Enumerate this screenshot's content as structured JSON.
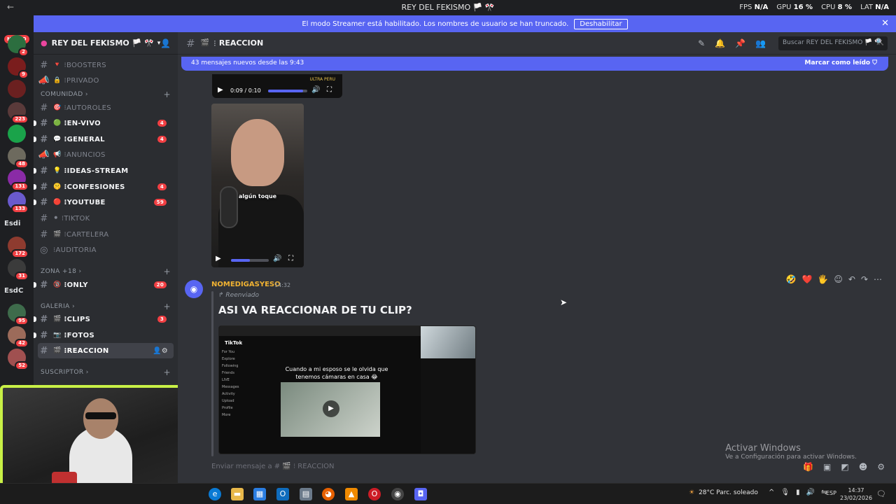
{
  "window": {
    "title": "REY DEL FEKISMO 🏳️ 🎌",
    "stats": [
      {
        "label": "FPS",
        "value": "N/A"
      },
      {
        "label": "GPU",
        "value": "16 %"
      },
      {
        "label": "CPU",
        "value": "8 %"
      },
      {
        "label": "LAT",
        "value": "N/A"
      }
    ]
  },
  "banner": {
    "text": "El modo Streamer está habilitado. Los nombres de usuario se han truncado.",
    "button": "Deshabilitar"
  },
  "rail": {
    "nuevo": "NUEVO",
    "servers": [
      {
        "badge": "2",
        "color": "#2c6e3f"
      },
      {
        "badge": "9",
        "color": "#7a1d1d"
      },
      {
        "badge": "",
        "color": "#6b2020"
      },
      {
        "badge": "223",
        "color": "#5a3a3a"
      },
      {
        "badge": "",
        "color": "#1aa34a"
      },
      {
        "badge": "48",
        "color": "#6d6a5e"
      },
      {
        "badge": "131",
        "color": "#8a2ba6"
      },
      {
        "badge": "133",
        "color": "#6a5acd"
      },
      {
        "badge": "",
        "color": "#1e1f22",
        "text": "Esdi"
      },
      {
        "badge": "172",
        "color": "#8e3b2f"
      },
      {
        "badge": "31",
        "color": "#3b3b3b"
      },
      {
        "badge": "",
        "color": "#1e1f22",
        "text": "EsdC"
      },
      {
        "badge": "95",
        "color": "#3e6b4b"
      },
      {
        "badge": "42",
        "color": "#9c6b5a"
      },
      {
        "badge": "52",
        "color": "#a05050"
      }
    ]
  },
  "sidebar": {
    "server_name": "REY DEL FEKISMO 🏳️ 🎌",
    "channels": [
      {
        "name": "BOOSTERS",
        "emoji": "🔻",
        "state": "muted",
        "count": ""
      },
      {
        "name": "PRIVADO",
        "emoji": "🔒",
        "state": "muted",
        "count": ""
      },
      {
        "name": "AUTOROLES",
        "emoji": "🎯",
        "state": "muted",
        "count": ""
      },
      {
        "name": "EN-VIVO",
        "emoji": "🟢",
        "state": "unread",
        "count": "4"
      },
      {
        "name": "GENERAL",
        "emoji": "💬",
        "state": "unread",
        "count": "4"
      },
      {
        "name": "ANUNCIOS",
        "emoji": "📢",
        "state": "muted",
        "count": ""
      },
      {
        "name": "IDEAS-STREAM",
        "emoji": "💡",
        "state": "unread",
        "count": ""
      },
      {
        "name": "CONFESIONES",
        "emoji": "🤫",
        "state": "unread",
        "count": "4"
      },
      {
        "name": "YOUTUBE",
        "emoji": "🔴",
        "state": "unread",
        "count": "59"
      },
      {
        "name": "TIKTOK",
        "emoji": "⚫",
        "state": "muted",
        "count": ""
      },
      {
        "name": "CARTELERA",
        "emoji": "🎬",
        "state": "muted",
        "count": ""
      },
      {
        "name": "AUDITORIA",
        "emoji": "",
        "state": "muted",
        "count": ""
      },
      {
        "name": "ONLY",
        "emoji": "🔞",
        "state": "unread",
        "count": "20"
      },
      {
        "name": "CLIPS",
        "emoji": "🎬",
        "state": "unread",
        "count": "3"
      },
      {
        "name": "FOTOS",
        "emoji": "📷",
        "state": "unread",
        "count": ""
      },
      {
        "name": "REACCION",
        "emoji": "🎬",
        "state": "active",
        "count": ""
      }
    ],
    "categories": [
      "COMUNIDAD",
      "ZONA +18",
      "GALERIA",
      "SUSCRIPTOR"
    ]
  },
  "header": {
    "channel": "REACCION",
    "search_placeholder": "Buscar REY DEL FEKISMO 🏳️ 🎌"
  },
  "chat": {
    "new_messages": "43 mensajes nuevos desde las 9:43",
    "mark_read": "Marcar como leído",
    "video1": {
      "time": "0:09 / 0:10",
      "brand": "ULTRA PERU",
      "progress": 0.9
    },
    "clip_caption": "algún toque",
    "clip_progress": 0.5,
    "message": {
      "author": "NOMEDIGASYESO",
      "time": "14:32",
      "forwarded": "Reenviado",
      "title": "ASI VA REACCIONAR DE TU CLIP?",
      "embed": {
        "brand": "TikTok",
        "caption": "Cuando a mi esposo se le olvida que tenemos cámaras en casa 😂",
        "sidebar": [
          "For You",
          "Explore",
          "Following",
          "Friends",
          "LIVE",
          "Messages",
          "Activity",
          "Upload",
          "Profile",
          "More"
        ]
      }
    },
    "composer_placeholder": "Enviar mensaje a # 🎬 ⁝ REACCION"
  },
  "watermark": {
    "title": "Activar Windows",
    "subtitle": "Ve a Configuración para activar Windows."
  },
  "taskbar": {
    "weather": "28°C  Parc. soleado",
    "lang": "ESP",
    "time": "14:37",
    "date": "23/02/2026"
  }
}
